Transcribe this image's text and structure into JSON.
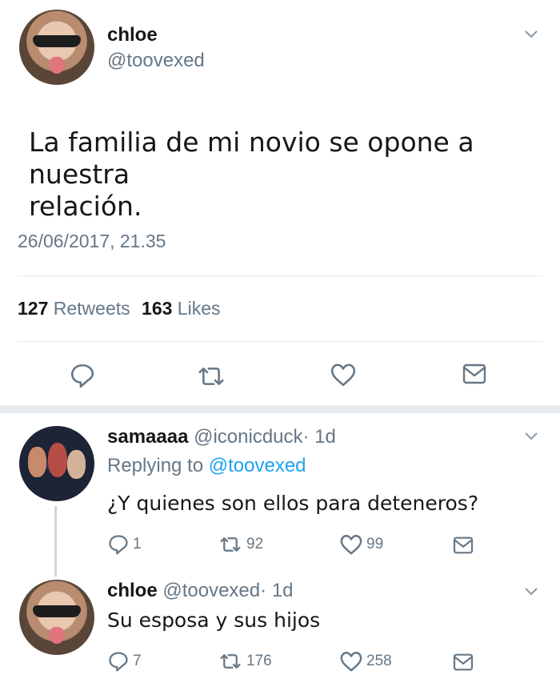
{
  "main_tweet": {
    "display_name": "chloe",
    "handle": "@toovexed",
    "text_line1": "La familia de mi novio se opone a nuestra",
    "text_line2": "relación.",
    "timestamp": "26/06/2017, 21.35",
    "retweets_count": "127",
    "retweets_label": "Retweets",
    "likes_count": "163",
    "likes_label": "Likes"
  },
  "reply_1": {
    "display_name": "samaaaa",
    "handle": "@iconicduck",
    "dot": "·",
    "age": "1d",
    "replying_prefix": "Replying to",
    "replying_handle": "@toovexed",
    "text": "¿Y quienes son ellos para deteneros?",
    "replies": "1",
    "retweets": "92",
    "likes": "99"
  },
  "reply_2": {
    "display_name": "chloe",
    "handle": "@toovexed",
    "dot": "·",
    "age": "1d",
    "text": "Su esposa y sus hijos",
    "replies": "7",
    "retweets": "176",
    "likes": "258"
  },
  "icons": [
    "chevron-down-icon",
    "reply-icon",
    "retweet-icon",
    "like-icon",
    "dm-icon"
  ],
  "colors": {
    "text": "#14171a",
    "muted": "#657786",
    "link": "#1da1f2",
    "divider": "#e1e8ed"
  }
}
